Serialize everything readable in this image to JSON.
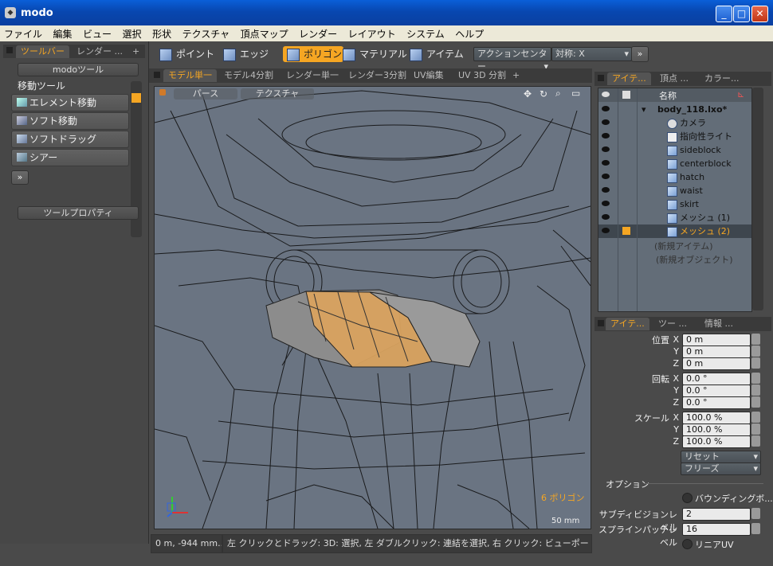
{
  "window": {
    "title": "modo",
    "min": "_",
    "max": "□",
    "close": "✕"
  },
  "menu": [
    "ファイル",
    "編集",
    "ビュー",
    "選択",
    "形状",
    "テクスチャ",
    "頂点マップ",
    "レンダー",
    "レイアウト",
    "システム",
    "ヘルプ"
  ],
  "left_panel": {
    "tabs": [
      "ツールバー",
      "レンダー ...",
      "+"
    ],
    "modo_tools": "modoツール",
    "move_tools_label": "移動ツール",
    "tools": [
      "エレメント移動",
      "ソフト移動",
      "ソフトドラッグ",
      "シアー"
    ],
    "expand": "»",
    "tool_properties": "ツールプロパティ"
  },
  "toolbar": {
    "modes": [
      "ポイント",
      "エッジ",
      "ポリゴン",
      "マテリアル",
      "アイテム"
    ],
    "active_mode": "ポリゴン",
    "action_center": "アクションセンター",
    "symmetry": "対称: X",
    "more": "»"
  },
  "viewport_tabs": [
    "モデル単一",
    "モデル4分割",
    "レンダー単一",
    "レンダー3分割",
    "UV編集",
    "UV 3D 分割",
    "+"
  ],
  "viewport": {
    "view_label": "パース",
    "shade_label": "テクスチャ",
    "polycount": "6 ポリゴン",
    "scale": "50 mm"
  },
  "status": {
    "coords": "0 m, -944 mm...",
    "hint": "左 クリックとドラッグ: 3D: 選択, 左 ダブルクリック: 連結を選択, 右 クリック: ビューポート (popup..."
  },
  "items_panel": {
    "tabs": [
      "アイテ...",
      "頂点 ...",
      "カラー..."
    ],
    "header": "名称",
    "items": [
      {
        "name": "body_118.lxo*",
        "level": 0,
        "bold": true
      },
      {
        "name": "カメラ",
        "level": 1
      },
      {
        "name": "指向性ライト",
        "level": 1
      },
      {
        "name": "sideblock",
        "level": 1
      },
      {
        "name": "centerblock",
        "level": 1
      },
      {
        "name": "hatch",
        "level": 1
      },
      {
        "name": "waist",
        "level": 1
      },
      {
        "name": "skirt",
        "level": 1
      },
      {
        "name": "メッシュ (1)",
        "level": 1
      },
      {
        "name": "メッシュ (2)",
        "level": 1,
        "selected": true
      }
    ],
    "new_item": "(新規アイテム)",
    "new_object": "(新規オブジェクト)"
  },
  "props_panel": {
    "tabs": [
      "アイテ...",
      "ツー ...",
      "情報 ..."
    ],
    "position_label": "位置",
    "rotation_label": "回転",
    "scale_label": "スケール",
    "axes": [
      "X",
      "Y",
      "Z"
    ],
    "position": [
      "0 m",
      "0 m",
      "0 m"
    ],
    "rotation": [
      "0.0 °",
      "0.0 °",
      "0.0 °"
    ],
    "scale": [
      "100.0 %",
      "100.0 %",
      "100.0 %"
    ],
    "reset": "リセット",
    "freeze": "フリーズ",
    "options_label": "オプション",
    "bounding_box": "バウンディングボ...",
    "subdiv_label": "サブディビジョンレベル",
    "subdiv_value": "2",
    "spline_label": "スプラインパッチレベル",
    "spline_value": "16",
    "linear_uv": "リニアUV"
  },
  "colors": {
    "accent": "#f5a623",
    "viewport_bg": "#6a7482",
    "titlebar": "#0a4fc8"
  }
}
